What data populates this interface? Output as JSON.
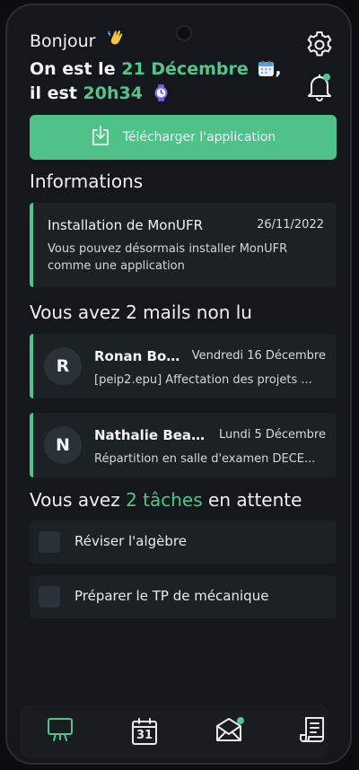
{
  "header": {
    "greeting": "Bonjour",
    "headline_prefix": "On est le",
    "date": "21 Décembre",
    "headline_mid": "il est",
    "time": "20h34"
  },
  "download_button": {
    "label": "Télécharger l'application"
  },
  "informations": {
    "title": "Informations",
    "items": [
      {
        "title": "Installation de MonUFR",
        "date": "26/11/2022",
        "body": "Vous pouvez désormais installer MonUFR comme une application"
      }
    ]
  },
  "mails": {
    "title": "Vous avez 2 mails non lu",
    "items": [
      {
        "initial": "R",
        "from": "Ronan Bo...",
        "date": "Vendredi 16 Décembre",
        "subject": "[peip2.epu] Affectation des projets ..."
      },
      {
        "initial": "N",
        "from": "Nathalie Beat...",
        "date": "Lundi 5 Décembre",
        "subject": "Répartition en salle d'examen DECE..."
      }
    ]
  },
  "tasks": {
    "title_prefix": "Vous avez",
    "count_label": "2 tâches",
    "title_suffix": "en attente",
    "items": [
      {
        "label": "Réviser l'algèbre",
        "checked": false
      },
      {
        "label": "Préparer le TP de mécanique",
        "checked": false
      }
    ]
  },
  "icons": {
    "settings": "gear-icon",
    "notifications": "bell-icon",
    "download": "download-icon",
    "nav": [
      "board-icon",
      "calendar-icon",
      "mail-icon",
      "document-icon"
    ]
  },
  "nav": {
    "calendar_day": "31",
    "active_index": 0
  },
  "colors": {
    "accent": "#55c48b",
    "background": "#14171b",
    "card": "#1c2126"
  }
}
